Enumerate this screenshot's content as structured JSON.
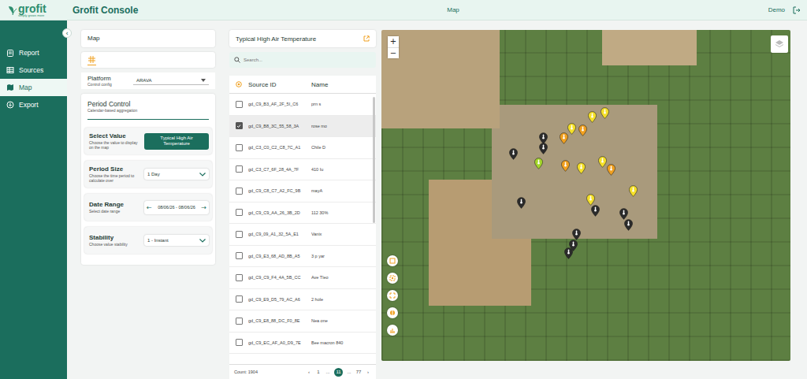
{
  "header": {
    "logo": "grofit",
    "tagline": "simply grows more",
    "title": "Grofit Console",
    "page": "Map",
    "user": "Demo"
  },
  "sidebar": {
    "collapse": "‹",
    "items": [
      {
        "label": "Report",
        "icon": "report",
        "selected": false
      },
      {
        "label": "Sources",
        "icon": "sources",
        "selected": false
      },
      {
        "label": "Map",
        "icon": "map",
        "selected": true
      },
      {
        "label": "Export",
        "icon": "export",
        "selected": false
      }
    ]
  },
  "control": {
    "title": "Map",
    "platform": {
      "label": "Platform",
      "sublabel": "Control config",
      "value": "ARAVA"
    },
    "period": {
      "title": "Period Control",
      "subtitle": "Calendar-based aggregation",
      "fields": [
        {
          "kind": "button",
          "label": "Select Value",
          "hint": "Choose the value to display on the map",
          "value": "Typical High Air Temperature"
        },
        {
          "kind": "dropdown",
          "label": "Period Size",
          "hint": "Choose the time period to calculate over",
          "value": "1 Day"
        },
        {
          "kind": "range",
          "label": "Date Range",
          "hint": "Select date range",
          "value": "08/06/26 - 08/06/26",
          "prev": "←",
          "next": "→"
        },
        {
          "kind": "dropdown",
          "label": "Stability",
          "hint": "Choose value stability",
          "value": "1 - Instant"
        }
      ]
    }
  },
  "list": {
    "title": "Typical High Air Temperature",
    "search": {
      "placeholder": "Search..."
    },
    "columns": [
      "Source ID",
      "Name"
    ],
    "rows": [
      {
        "id": "gd_C9_B3_AF_2F_5I_C6",
        "name": "prn s",
        "checked": false,
        "selected": false
      },
      {
        "id": "gd_C9_B8_3C_55_58_3A",
        "name": "rose mo",
        "checked": true,
        "selected": true
      },
      {
        "id": "gd_C3_C0_C2_C8_7C_A1",
        "name": "Chile D",
        "checked": false,
        "selected": false
      },
      {
        "id": "gd_C3_C7_6F_28_4A_7F",
        "name": "410 Iu",
        "checked": false,
        "selected": false
      },
      {
        "id": "gd_C9_C8_C7_A2_FC_9B",
        "name": "mayA",
        "checked": false,
        "selected": false
      },
      {
        "id": "gd_C9_C9_AA_26_3B_2D",
        "name": "112 30%",
        "checked": false,
        "selected": false
      },
      {
        "id": "gd_C9_09_A1_32_5A_E1",
        "name": "Vanix",
        "checked": false,
        "selected": false
      },
      {
        "id": "gd_C9_E3_68_AD_8B_A5",
        "name": "3 p yar",
        "checked": false,
        "selected": false
      },
      {
        "id": "gd_C9_C9_F4_4A_5B_CC",
        "name": "Ave Tleo",
        "checked": false,
        "selected": false
      },
      {
        "id": "gd_C9_E9_D5_79_AC_A6",
        "name": "2 hole",
        "checked": false,
        "selected": false
      },
      {
        "id": "gd_C9_E8_88_DC_F0_8E",
        "name": "Nea one",
        "checked": false,
        "selected": false
      },
      {
        "id": "gd_C9_EC_AF_A0_D9_7E",
        "name": "Bee macron 840",
        "checked": false,
        "selected": false
      }
    ],
    "count": "Count: 1904",
    "prev": "‹",
    "next": "›",
    "pages": [
      {
        "label": "1",
        "selected": false
      },
      {
        "label": "...",
        "selected": false
      },
      {
        "label": "11",
        "selected": true
      },
      {
        "label": "...",
        "selected": false
      },
      {
        "label": "77",
        "selected": false
      }
    ]
  },
  "map": {
    "zoom_in": "+",
    "zoom_out": "−",
    "pins": [
      {
        "color": "#2b2b2b"
      },
      {
        "color": "#2b2b2b"
      },
      {
        "color": "#2b2b2b"
      },
      {
        "color": "#a4d62a"
      },
      {
        "color": "#f0a020"
      },
      {
        "color": "#f5e02a"
      },
      {
        "color": "#f5e02a"
      },
      {
        "color": "#f5e02a"
      },
      {
        "color": "#f0a020"
      },
      {
        "color": "#f5e02a"
      },
      {
        "color": "#f5e02a"
      },
      {
        "color": "#f0a020"
      },
      {
        "color": "#f5e02a"
      },
      {
        "color": "#f5e02a"
      },
      {
        "color": "#2b2b2b"
      },
      {
        "color": "#2b2b2b"
      },
      {
        "color": "#2b2b2b"
      },
      {
        "color": "#2b2b2b"
      },
      {
        "color": "#2b2b2b"
      },
      {
        "color": "#2b2b2b"
      },
      {
        "color": "#2b2b2b"
      },
      {
        "color": "#f0a020"
      }
    ]
  }
}
